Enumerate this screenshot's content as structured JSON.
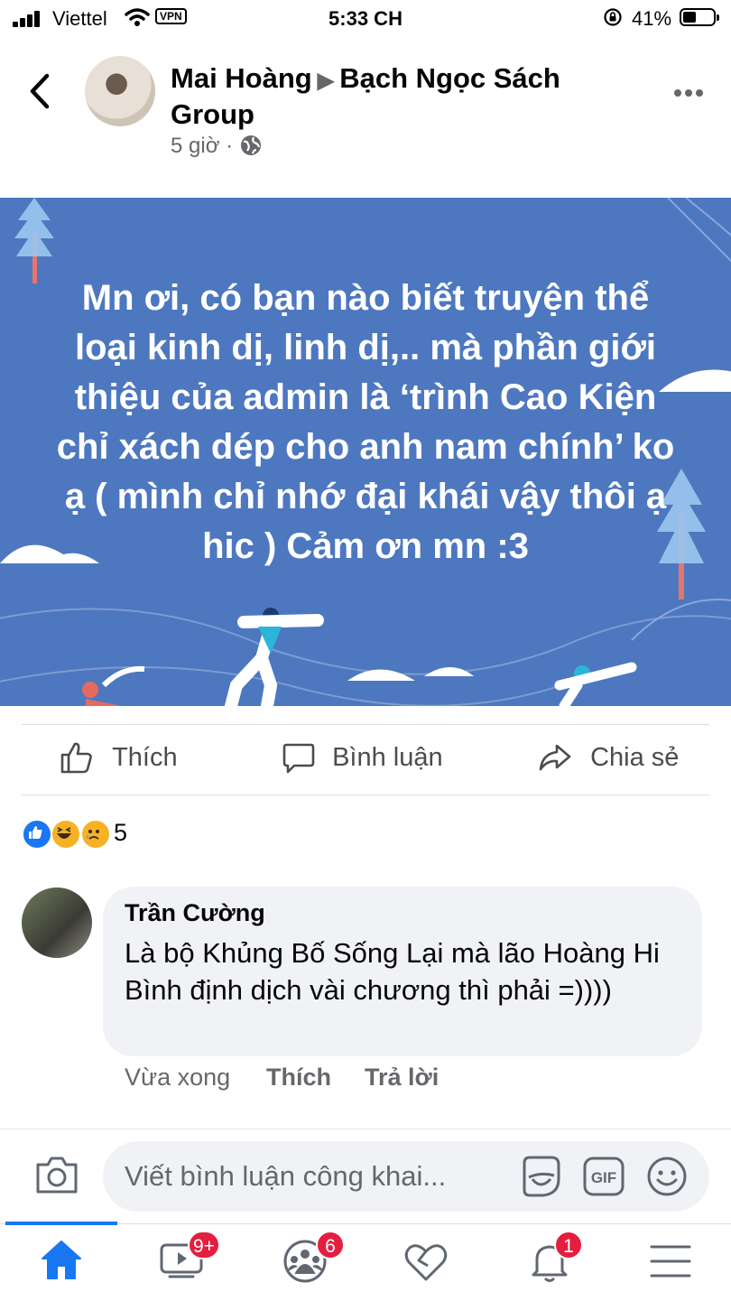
{
  "status_bar": {
    "carrier": "Viettel",
    "vpn": "VPN",
    "time": "5:33 CH",
    "battery": "41%"
  },
  "post": {
    "author": "Mai Hoàng",
    "group": "Bạch Ngọc Sách Group",
    "time": "5 giờ",
    "separator": "·",
    "privacy_icon": "globe-icon",
    "background_color": "#4d78c0",
    "text": "Mn ơi, có bạn nào biết truyện thể loại kinh dị, linh dị,.. mà phần giới thiệu của admin là ‘trình Cao Kiện chỉ xách dép cho anh nam chính’ ko ạ ( mình chỉ nhớ đại khái vậy thôi ạ hic ) Cảm ơn mn :3"
  },
  "actions": {
    "like": "Thích",
    "comment": "Bình luận",
    "share": "Chia sẻ"
  },
  "reactions": {
    "types": [
      "like",
      "haha",
      "sad"
    ],
    "count": "5"
  },
  "comment": {
    "author": "Trần Cường",
    "text": "Là bộ Khủng Bố Sống Lại mà lão Hoàng Hi Bình định dịch vài chương thì phải =))))",
    "time": "Vừa xong",
    "like": "Thích",
    "reply": "Trả lời"
  },
  "composer": {
    "placeholder": "Viết bình luận công khai..."
  },
  "tab_bar": {
    "watch_badge": "9+",
    "groups_badge": "6",
    "notifications_badge": "1",
    "accent": "#1877f2"
  }
}
